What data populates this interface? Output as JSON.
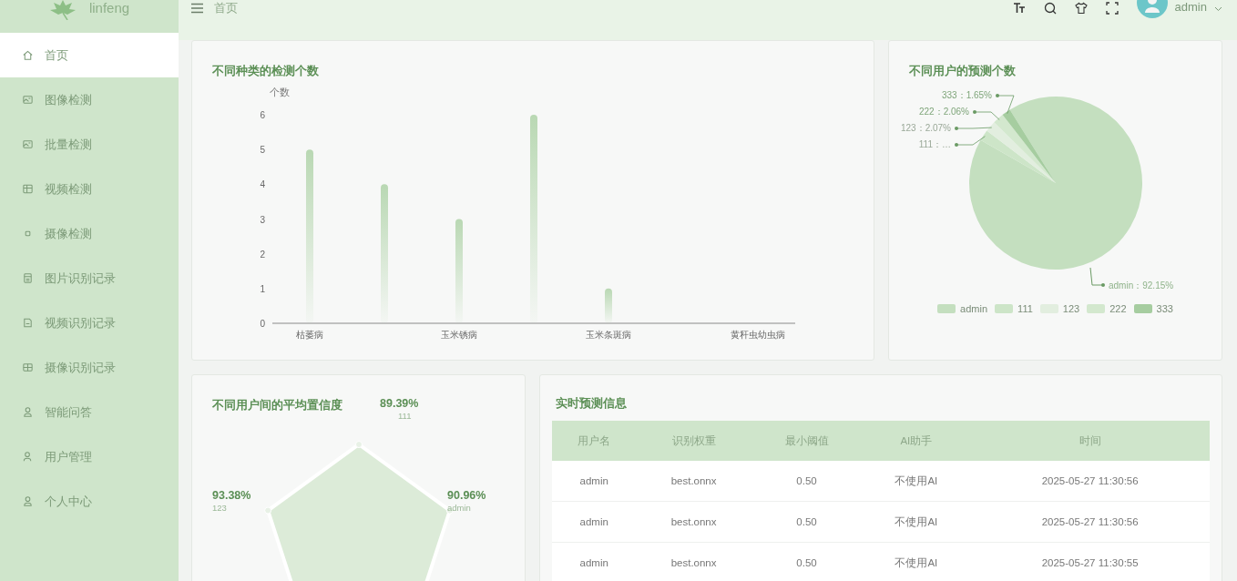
{
  "sidebar": {
    "logo": "linfeng",
    "items": [
      {
        "label": "首页",
        "kind": "home",
        "selected": true
      },
      {
        "label": "图像检测",
        "kind": "image",
        "selected": false
      },
      {
        "label": "批量检测",
        "kind": "image",
        "selected": false
      },
      {
        "label": "视频检测",
        "kind": "video",
        "selected": false
      },
      {
        "label": "摄像检测",
        "kind": "camera",
        "selected": false
      },
      {
        "label": "图片识别记录",
        "kind": "file",
        "selected": false
      },
      {
        "label": "视频识别记录",
        "kind": "doc",
        "selected": false
      },
      {
        "label": "摄像识别记录",
        "kind": "grid",
        "selected": false
      },
      {
        "label": "智能问答",
        "kind": "user",
        "selected": false
      },
      {
        "label": "用户管理",
        "kind": "users",
        "selected": false
      },
      {
        "label": "个人中心",
        "kind": "user",
        "selected": false
      }
    ]
  },
  "header": {
    "breadcrumb": "首页",
    "user": "admin"
  },
  "bar_card": {
    "title": "不同种类的检测个数",
    "chart_data": {
      "type": "bar",
      "ylabel": "个数",
      "categories": [
        "枯萎病",
        null,
        "玉米锈病",
        null,
        "玉米条斑病",
        null,
        "黄秆虫幼虫病"
      ],
      "values": [
        5,
        4,
        3,
        6,
        1,
        0,
        0
      ],
      "ylim": [
        0,
        6
      ],
      "yticks": [
        0,
        1,
        2,
        3,
        4,
        5,
        6
      ]
    }
  },
  "pie_card": {
    "title": "不同用户的预测个数",
    "chart_data": {
      "type": "pie",
      "categories": [
        "admin",
        "111",
        "123",
        "222",
        "333"
      ],
      "values": [
        92.15,
        2.07,
        2.07,
        2.06,
        1.65
      ],
      "value_labels": [
        "admin：92.15%",
        "111：…",
        "123：2.07%",
        "222：2.06%",
        "333：1.65%"
      ]
    }
  },
  "radar_card": {
    "title": "不同用户间的平均置信度",
    "points": [
      {
        "value": "89.39%",
        "name": "111"
      },
      {
        "value": "93.38%",
        "name": "123"
      },
      {
        "value": "90.96%",
        "name": "admin"
      }
    ]
  },
  "table_card": {
    "title": "实时预测信息",
    "columns": [
      "用户名",
      "识别权重",
      "最小阈值",
      "AI助手",
      "时间"
    ],
    "rows": [
      [
        "admin",
        "best.onnx",
        "0.50",
        "不使用AI",
        "2025-05-27 11:30:56"
      ],
      [
        "admin",
        "best.onnx",
        "0.50",
        "不使用AI",
        "2025-05-27 11:30:56"
      ],
      [
        "admin",
        "best.onnx",
        "0.50",
        "不使用AI",
        "2025-05-27 11:30:55"
      ]
    ]
  }
}
